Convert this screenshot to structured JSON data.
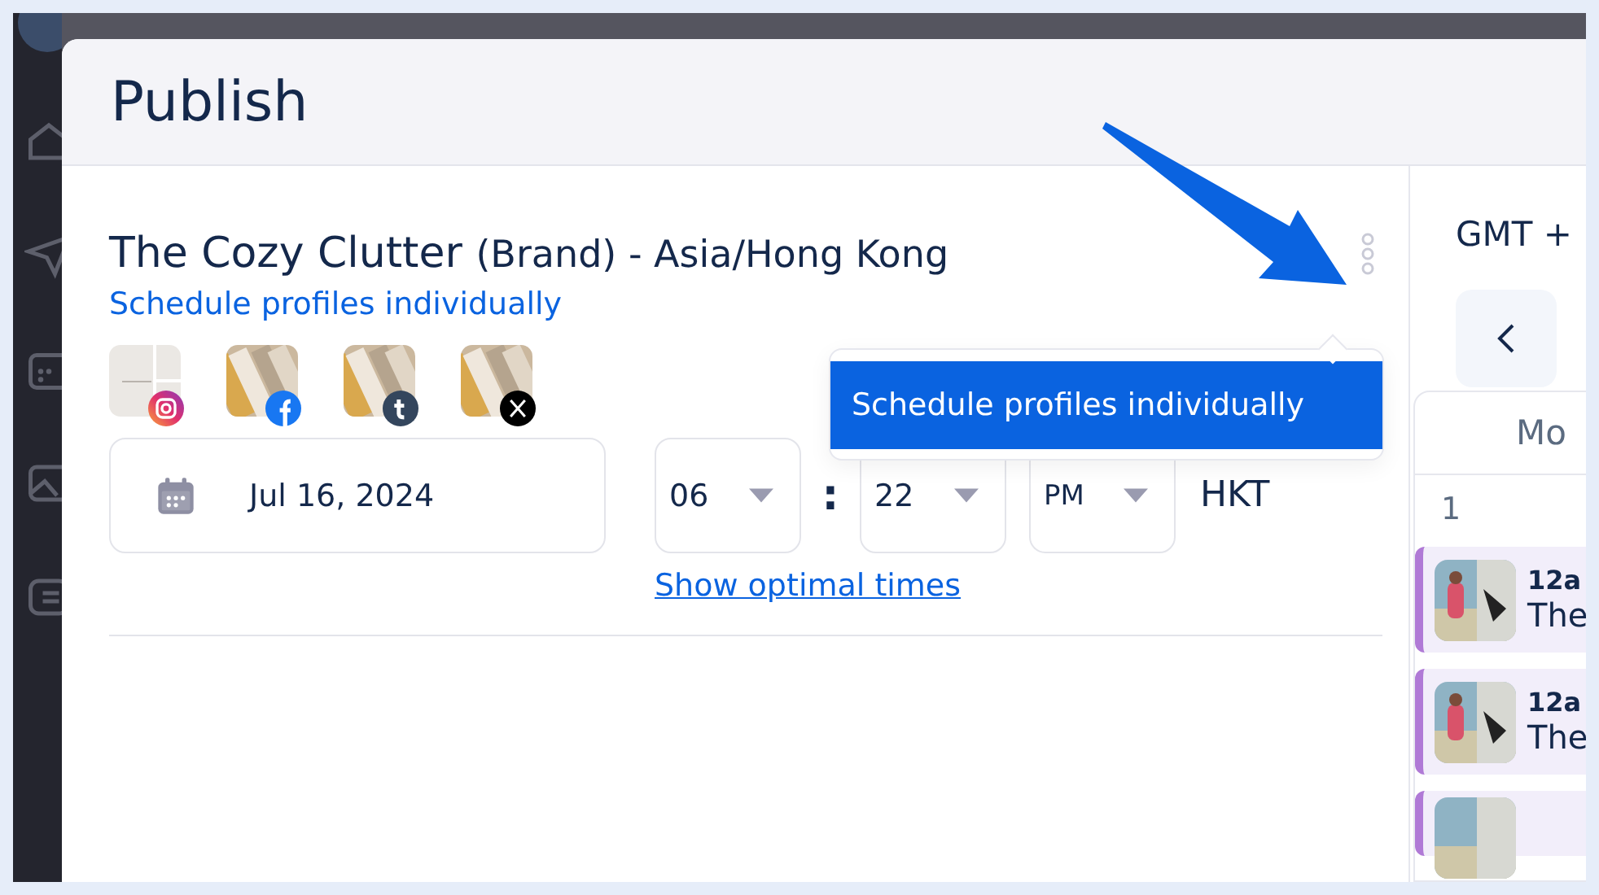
{
  "modal": {
    "title": "Publish"
  },
  "brand": {
    "name": "The Cozy Clutter",
    "suffix": "(Brand) - Asia/Hong Kong"
  },
  "schedule_link": "Schedule profiles individually",
  "profiles": [
    {
      "kind": "instagram"
    },
    {
      "kind": "facebook"
    },
    {
      "kind": "tumblr"
    },
    {
      "kind": "x"
    }
  ],
  "date": {
    "value": "Jul 16, 2024"
  },
  "time": {
    "hour": "06",
    "separator": ":",
    "minute": "22",
    "period": "PM",
    "zone": "HKT"
  },
  "optimal_link": "Show optimal times",
  "tooltip": "Schedule profiles individually",
  "calendar": {
    "timezone": "GMT +",
    "day_header": "Mo",
    "day_number": "1",
    "events": [
      {
        "time": "12a",
        "title": "The"
      },
      {
        "time": "12a",
        "title": "The"
      }
    ]
  }
}
